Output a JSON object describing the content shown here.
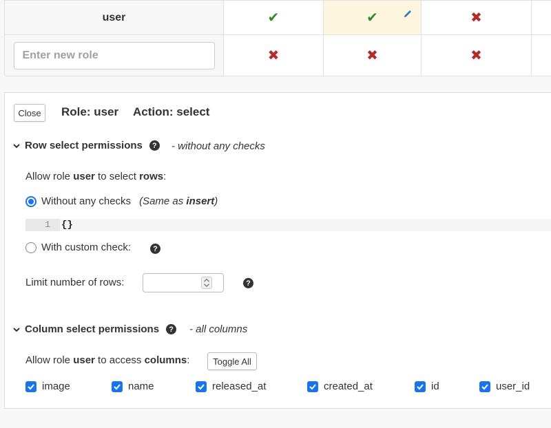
{
  "grid": {
    "rows": [
      {
        "role": "user",
        "cells": [
          "check",
          "check",
          "cross"
        ]
      },
      {
        "role_input_placeholder": "Enter new role",
        "cells": [
          "cross",
          "cross",
          "cross"
        ]
      }
    ]
  },
  "panel": {
    "close_label": "Close",
    "role_heading": "Role: user",
    "action_heading": "Action: select",
    "row_section": {
      "title": "Row select permissions",
      "summary": "- without any checks",
      "allow_prefix": "Allow role ",
      "allow_role": "user",
      "allow_mid": " to select ",
      "allow_target": "rows",
      "allow_suffix": ":",
      "option_without_checks": "Without any checks",
      "same_as_prefix": "(Same as ",
      "same_as_target": "insert",
      "same_as_suffix": ")",
      "editor_line_number": "1",
      "editor_code": "{}",
      "option_custom_check": "With custom check:",
      "limit_label": "Limit number of rows:",
      "limit_value": ""
    },
    "column_section": {
      "title": "Column select permissions",
      "summary": "- all columns",
      "allow_prefix": "Allow role ",
      "allow_role": "user",
      "allow_mid": " to access ",
      "allow_target": "columns",
      "allow_suffix": ":",
      "toggle_all_label": "Toggle All",
      "columns": [
        {
          "name": "image",
          "checked": true
        },
        {
          "name": "name",
          "checked": true
        },
        {
          "name": "released_at",
          "checked": true
        },
        {
          "name": "created_at",
          "checked": true
        },
        {
          "name": "id",
          "checked": true
        },
        {
          "name": "user_id",
          "checked": true
        }
      ]
    }
  },
  "colors": {
    "accent": "#1a73e8",
    "check": "#2e8b2e",
    "cross": "#b52b2b",
    "highlight": "#fdf5dd"
  }
}
